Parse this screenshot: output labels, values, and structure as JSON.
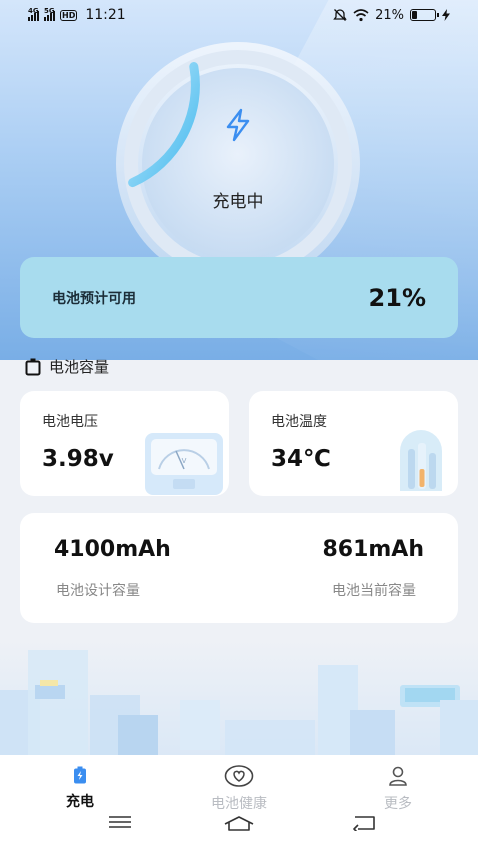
{
  "status_bar": {
    "sim1": "4G",
    "sim2": "5G",
    "hd": "HD",
    "time": "11:21",
    "battery_percent": "21%",
    "battery_level": 0.21
  },
  "charging": {
    "status_label": "充电中",
    "progress": 0.21,
    "icon": "lightning-bolt-icon"
  },
  "battery_available": {
    "label": "电池预计可用",
    "value": "21%"
  },
  "section": {
    "title": "电池容量"
  },
  "voltage": {
    "label": "电池电压",
    "value": "3.98v"
  },
  "temperature": {
    "label": "电池温度",
    "value": "34℃"
  },
  "capacity": {
    "design_value": "4100mAh",
    "design_label": "电池设计容量",
    "current_value": "861mAh",
    "current_label": "电池当前容量"
  },
  "tabs": [
    {
      "label": "充电",
      "icon": "battery-charging-icon",
      "active": true
    },
    {
      "label": "电池健康",
      "icon": "heart-icon",
      "active": false
    },
    {
      "label": "更多",
      "icon": "person-icon",
      "active": false
    }
  ],
  "colors": {
    "accent": "#3b8ef0",
    "progress_arc": "#56c3f0",
    "available_card": "#a8dcee"
  }
}
